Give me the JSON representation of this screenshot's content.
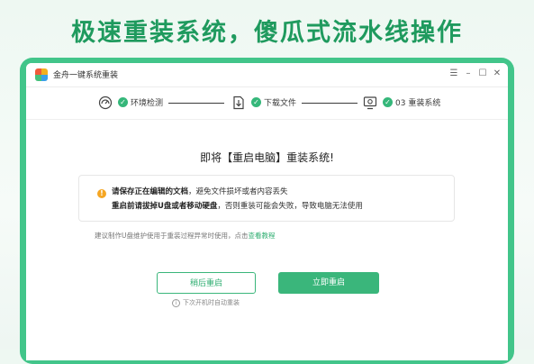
{
  "headline": "极速重装系统，傻瓜式流水线操作",
  "window": {
    "title": "金舟一键系统重装",
    "controls": {
      "menu": "☰",
      "minimize": "–",
      "maximize": "☐",
      "close": "✕"
    }
  },
  "steps": [
    {
      "icon": "monitor-scan-icon",
      "label": "环境检测",
      "done": true
    },
    {
      "icon": "download-file-icon",
      "label": "下载文件",
      "done": true
    },
    {
      "icon": "monitor-system-icon",
      "label": "03 重装系统",
      "done": true
    }
  ],
  "main": {
    "title": "即将【重启电脑】重装系统!",
    "notice": {
      "line1_bold": "请保存正在编辑的文档",
      "line1_rest": "，避免文件损坏或者内容丢失",
      "line2_bold": "重启前请拔掉U盘或者移动硬盘",
      "line2_rest": "，否则重装可能会失败，导致电脑无法使用"
    },
    "hint_text": "建议制作U盘维护使用于重装过程异常时使用，点击",
    "hint_link": "查看教程",
    "buttons": {
      "later": "稍后重启",
      "now": "立即重启"
    },
    "sub_note": "下次开机时自动重装"
  },
  "colors": {
    "accent": "#3ab67b",
    "headline": "#1f9a5e",
    "frame": "#42c58a",
    "warning": "#f5a623"
  }
}
